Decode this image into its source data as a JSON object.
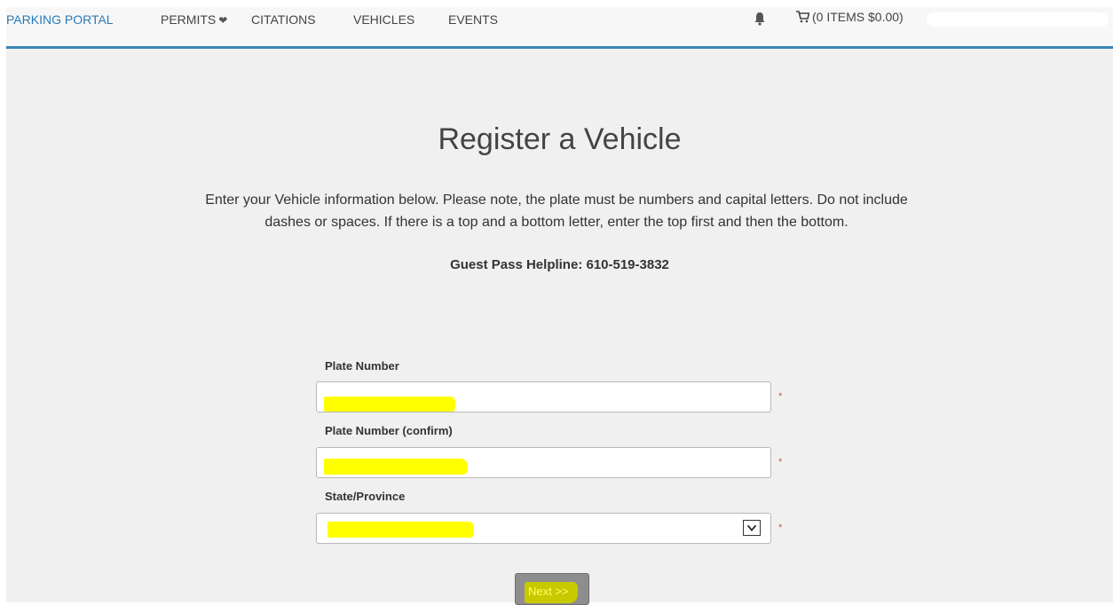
{
  "nav": {
    "brand": "PARKING PORTAL",
    "permits": "PERMITS",
    "citations": "CITATIONS",
    "vehicles": "VEHICLES",
    "events": "EVENTS",
    "cart": "(0 ITEMS $0.00)",
    "accent_color": "#2a7ab8"
  },
  "main": {
    "title": "Register a Vehicle",
    "intro": "Enter your Vehicle information below. Please note, the plate must be numbers and capital letters. Do not include dashes or spaces. If there is a top and a bottom letter, enter the top first and then the bottom.",
    "helpline": "Guest Pass Helpline: 610-519-3832"
  },
  "form": {
    "plate_label": "Plate Number",
    "plate_confirm_label": "Plate Number (confirm)",
    "state_label": "State/Province",
    "required_mark": "*",
    "next_label": "Next >>"
  },
  "icons": [
    "bell-icon",
    "cart-icon",
    "heart-icon",
    "chevron-down-icon"
  ],
  "colors": {
    "redaction": "#ffff00",
    "nav_underline": "#3a86b4",
    "required": "#d9534f"
  }
}
